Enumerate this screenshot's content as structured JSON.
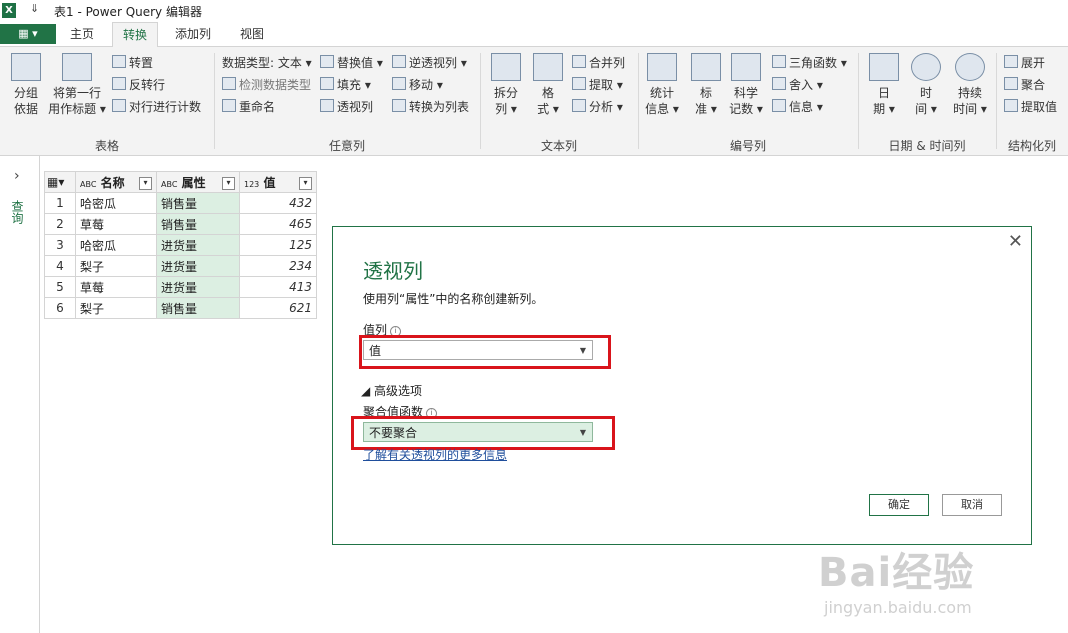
{
  "window": {
    "app_icon": "excel-icon",
    "quick_access": "⇓",
    "title": "表1 - Power Query 编辑器"
  },
  "ribbon_tabs": {
    "file_label": "▦ ▾",
    "tabs": [
      "主页",
      "转换",
      "添加列",
      "视图"
    ],
    "active": "转换"
  },
  "ribbon": {
    "table_group": {
      "label": "表格",
      "group_by": [
        "分组",
        "依据"
      ],
      "first_row_header": [
        "将第一行",
        "用作标题 ▾"
      ],
      "transpose": "转置",
      "reverse_rows": "反转行",
      "count_rows": "对行进行计数"
    },
    "any_column_group": {
      "label": "任意列",
      "data_type": "数据类型: 文本 ▾",
      "detect_type": "检测数据类型",
      "rename": "重命名",
      "replace_values": "替换值 ▾",
      "fill": "填充 ▾",
      "pivot": "透视列",
      "unpivot": "逆透视列 ▾",
      "move": "移动 ▾",
      "to_list": "转换为列表"
    },
    "text_column_group": {
      "label": "文本列",
      "split": [
        "拆分",
        "列 ▾"
      ],
      "format": [
        "格",
        "式 ▾"
      ],
      "merge": "合并列",
      "extract": "提取 ▾",
      "parse": "分析 ▾"
    },
    "number_column_group": {
      "label": "编号列",
      "statistics": [
        "统计",
        "信息 ▾"
      ],
      "standard": [
        "标",
        "准 ▾"
      ],
      "scientific": [
        "科学",
        "记数 ▾"
      ],
      "trig": "三角函数 ▾",
      "rounding": "舍入 ▾",
      "information": "信息 ▾"
    },
    "datetime_group": {
      "label": "日期 & 时间列",
      "date": [
        "日",
        "期 ▾"
      ],
      "time": [
        "时",
        "间 ▾"
      ],
      "duration": [
        "持续",
        "时间 ▾"
      ]
    },
    "structured_group": {
      "label": "结构化列",
      "expand": "展开",
      "aggregate": "聚合",
      "extract_values": "提取值"
    }
  },
  "left_pane": {
    "expand_glyph": "›",
    "label": "查询"
  },
  "grid": {
    "headers": [
      {
        "type": "ABC",
        "name": "名称"
      },
      {
        "type": "ABC",
        "name": "属性"
      },
      {
        "type": "123",
        "name": "值"
      }
    ],
    "rows": [
      {
        "n": "1",
        "name": "哈密瓜",
        "attr": "销售量",
        "val": "432"
      },
      {
        "n": "2",
        "name": "草莓",
        "attr": "销售量",
        "val": "465"
      },
      {
        "n": "3",
        "name": "哈密瓜",
        "attr": "进货量",
        "val": "125"
      },
      {
        "n": "4",
        "name": "梨子",
        "attr": "进货量",
        "val": "234"
      },
      {
        "n": "5",
        "name": "草莓",
        "attr": "进货量",
        "val": "413"
      },
      {
        "n": "6",
        "name": "梨子",
        "attr": "销售量",
        "val": "621"
      }
    ]
  },
  "dialog": {
    "title": "透视列",
    "description": "使用列“属性”中的名称创建新列。",
    "value_column_label": "值列",
    "value_column_selected": "值",
    "advanced_toggle": "◢ 高级选项",
    "aggregate_label": "聚合值函数",
    "aggregate_selected": "不要聚合",
    "learn_more": "了解有关透视列的更多信息",
    "ok": "确定",
    "cancel": "取消",
    "close": "✕"
  },
  "watermark": {
    "brand": "Bai经验",
    "url": "jingyan.baidu.com"
  }
}
